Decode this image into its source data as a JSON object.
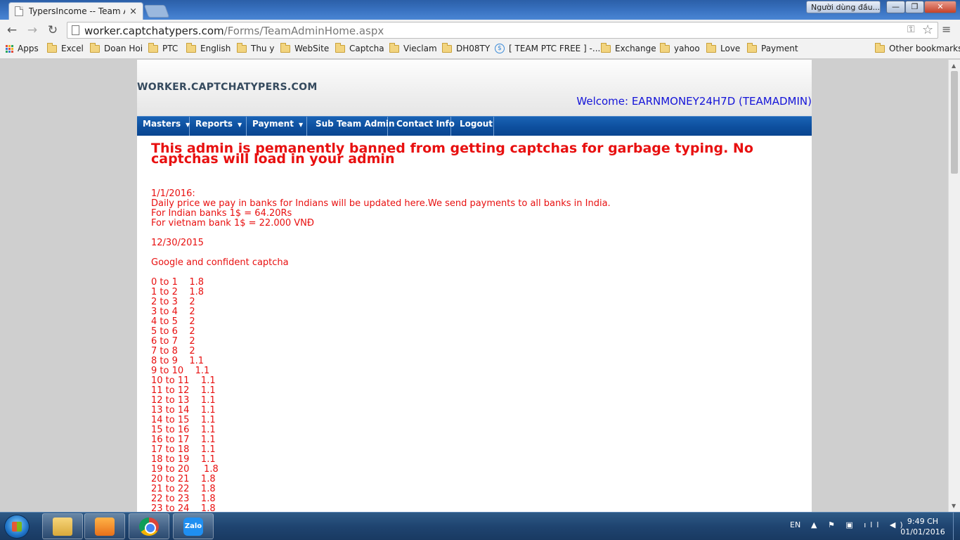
{
  "browser": {
    "tab_title": "TypersIncome -- Team Ad",
    "tab_close": "×",
    "profile_label": "Người dùng đầu...",
    "window_controls": {
      "minimize": "—",
      "maximize": "❐",
      "close": "✕"
    },
    "url_host": "worker.captchatypers.com",
    "url_path": "/Forms/TeamAdminHome.aspx",
    "icons": {
      "back": "←",
      "forward": "→",
      "reload": "↻",
      "key": "⚿",
      "star": "☆",
      "menu": "≡"
    }
  },
  "bookmarks": {
    "apps": "Apps",
    "items": [
      "Excel",
      "Doan Hoi",
      "PTC",
      "English",
      "Thu y",
      "WebSite",
      "Captcha",
      "Vieclam",
      "DH08TY",
      "[ TEAM PTC FREE ] -...",
      "Exchange",
      "yahoo",
      "Love",
      "Payment"
    ],
    "other": "Other bookmarks"
  },
  "site": {
    "name": "WORKER.CAPTCHATYPERS.COM",
    "welcome": "Welcome: EARNMONEY24H7D (TEAMADMIN)"
  },
  "menu": {
    "items": [
      "Masters",
      "Reports",
      "Payment",
      "Sub Team Admin",
      "Contact Info",
      "Logout"
    ],
    "caret": "▼"
  },
  "content": {
    "banner": "This admin is pemanently banned from getting captchas for garbage typing. No captchas will load in your admin",
    "notice_lines": [
      "1/1/2016:",
      "Daily price we pay in banks for Indians will be updated here.We send payments to all banks in India.",
      "For Indian banks 1$ = 64.20Rs",
      "For vietnam bank 1$ = 22.000 VNĐ",
      "",
      "12/30/2015",
      "",
      "Google and confident captcha",
      "",
      "0 to 1    1.8",
      "1 to 2    1.8",
      "2 to 3    2",
      "3 to 4    2",
      "4 to 5    2",
      "5 to 6    2",
      "6 to 7    2",
      "7 to 8    2",
      "8 to 9    1.1",
      "9 to 10    1.1",
      "10 to 11    1.1",
      "11 to 12    1.1",
      "12 to 13    1.1",
      "13 to 14    1.1",
      "14 to 15    1.1",
      "15 to 16    1.1",
      "16 to 17    1.1",
      "17 to 18    1.1",
      "18 to 19    1.1",
      "19 to 20     1.8",
      "20 to 21    1.8",
      "21 to 22    1.8",
      "22 to 23    1.8",
      "23 to 24    1.8"
    ]
  },
  "taskbar": {
    "zalo_label": "Zalo",
    "language": "EN",
    "tray_glyphs": "▲ ⚑ ▣ ıll ◀)",
    "time": "9:49 CH",
    "date": "01/01/2016"
  },
  "scrollbar": {
    "up": "▲",
    "down": "▼"
  }
}
